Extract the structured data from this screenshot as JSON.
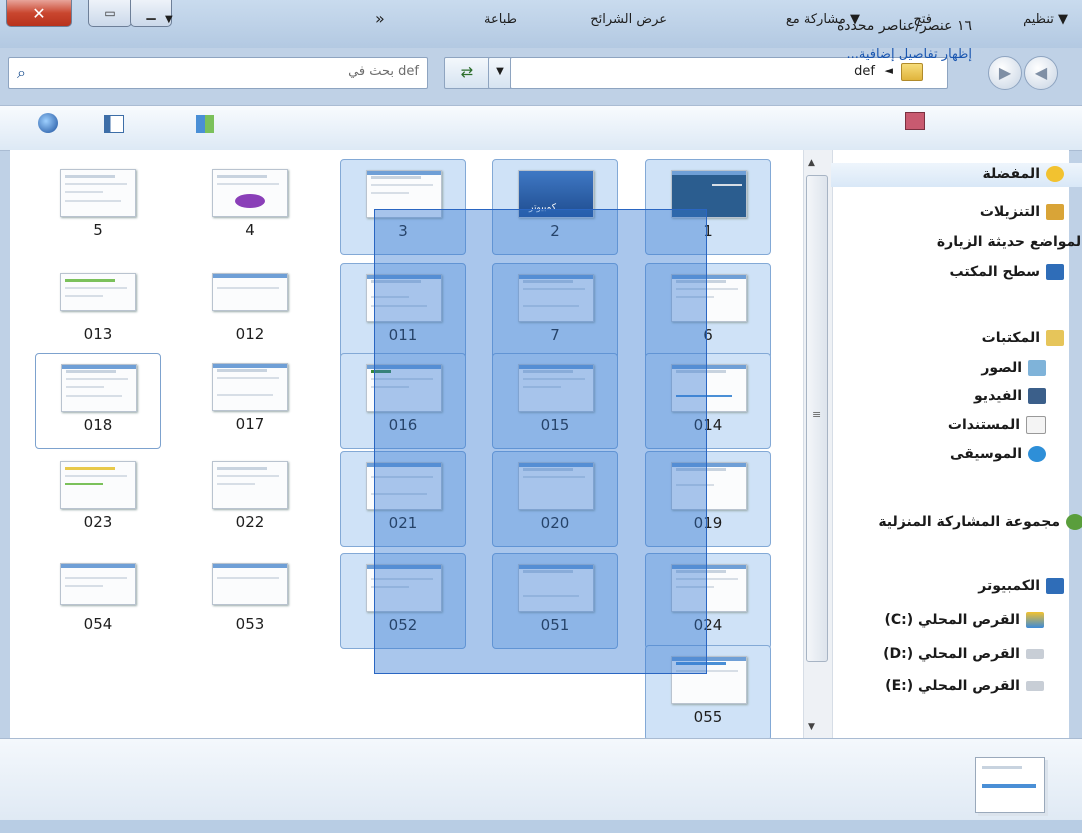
{
  "window": {
    "close_symbol": "✕",
    "maximize_symbol": "▭",
    "minimize_symbol": "▁"
  },
  "address": {
    "search_placeholder": "بحث في def",
    "search_icon": "search-icon",
    "refresh_symbol": "⇄",
    "dropdown_symbol": "▼",
    "breadcrumb": "def",
    "breadcrumb_chevron": "◄",
    "back_symbol": "◀",
    "forward_symbol": "▶"
  },
  "toolbar": {
    "organize": "تنظيم ▼",
    "open": "فتح",
    "share_with": "مشاركة مع ▼",
    "slideshow": "عرض الشرائح",
    "print": "طباعة",
    "more": "»",
    "views_icon": "views-icon",
    "views_dropdown": "▼",
    "preview_pane_icon": "preview-pane-icon",
    "help_icon": "help-icon"
  },
  "nav": {
    "favorites": "المفضلة",
    "downloads": "التنزيلات",
    "recent_places": "المواضع حديثة الزيارة",
    "desktop": "سطح المكتب",
    "libraries": "المكتبات",
    "pictures": "الصور",
    "videos": "الفيديو",
    "documents": "المستندات",
    "music": "الموسيقى",
    "homegroup": "مجموعة المشاركة المنزلية",
    "computer": "الكمبيوتر",
    "drive_c": "القرص المحلي (:C)",
    "drive_d": "القرص المحلي (:D)",
    "drive_e": "القرص المحلي (:E)"
  },
  "tiles": {
    "t1": "1",
    "t2": "2",
    "t3": "3",
    "t4": "4",
    "t5": "5",
    "t6": "6",
    "t7": "7",
    "t011": "011",
    "t012": "012",
    "t013": "013",
    "t014": "014",
    "t015": "015",
    "t016": "016",
    "t017": "017",
    "t018": "018",
    "t019": "019",
    "t020": "020",
    "t021": "021",
    "t022": "022",
    "t023": "023",
    "t024": "024",
    "t051": "051",
    "t052": "052",
    "t053": "053",
    "t054": "054",
    "t055": "055",
    "t2_caption": "كمبيوتر"
  },
  "status": {
    "count": "١٦ عنصر/عناصر محددة",
    "details_link": "إظهار تفاصيل إضافية..."
  },
  "colors": {
    "selection": "#cfe2f7",
    "marquee": "#3378d2",
    "link": "#1a56b0"
  }
}
